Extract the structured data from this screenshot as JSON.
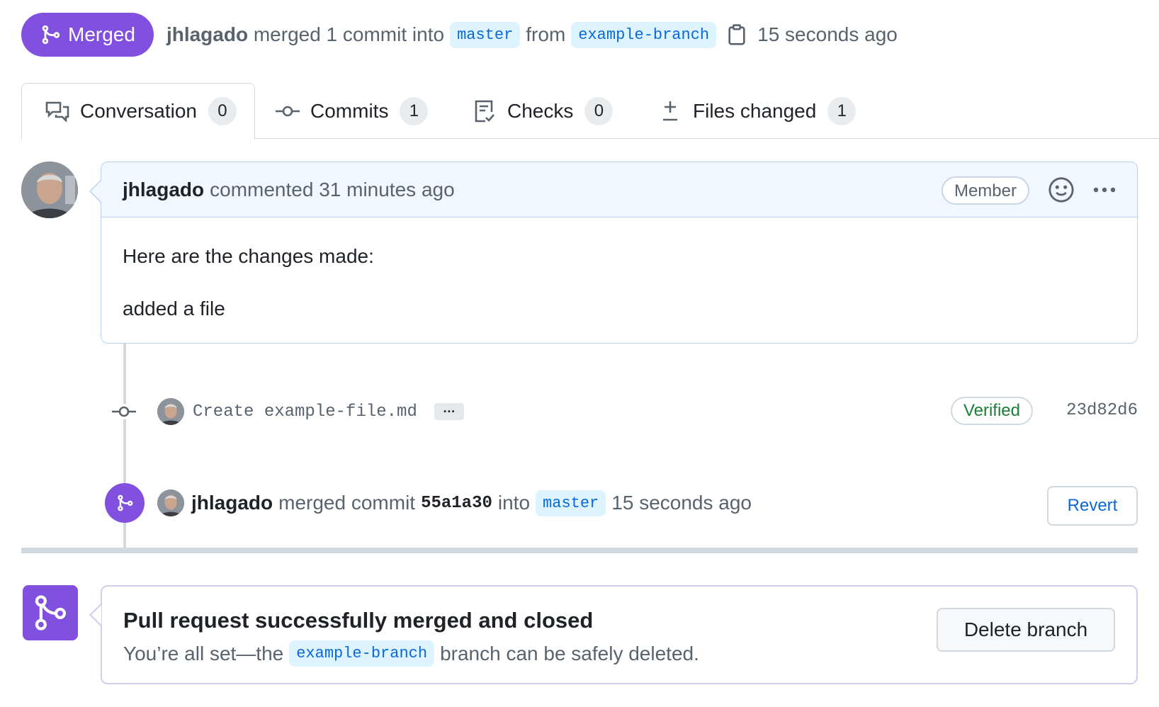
{
  "header": {
    "state_label": "Merged",
    "author": "jhlagado",
    "action_text": "merged 1 commit into",
    "base_branch": "master",
    "from_text": "from",
    "head_branch": "example-branch",
    "time": "15 seconds ago"
  },
  "tabs": [
    {
      "label": "Conversation",
      "count": "0",
      "icon": "comment-discussion-icon"
    },
    {
      "label": "Commits",
      "count": "1",
      "icon": "git-commit-icon"
    },
    {
      "label": "Checks",
      "count": "0",
      "icon": "checklist-icon"
    },
    {
      "label": "Files changed",
      "count": "1",
      "icon": "file-diff-icon"
    }
  ],
  "comment": {
    "author": "jhlagado",
    "meta": "commented 31 minutes ago",
    "role_badge": "Member",
    "body_line1": "Here are the changes made:",
    "body_line2": "added a file"
  },
  "commit": {
    "message": "Create example-file.md",
    "ellipsis": "…",
    "verified_label": "Verified",
    "sha": "23d82d6"
  },
  "merge_event": {
    "author": "jhlagado",
    "text_before": "merged commit",
    "sha": "55a1a30",
    "text_into": "into",
    "branch": "master",
    "time": "15 seconds ago",
    "revert_label": "Revert"
  },
  "merged_box": {
    "title": "Pull request successfully merged and closed",
    "sub_before": "You’re all set—the",
    "branch": "example-branch",
    "sub_after": "branch can be safely deleted.",
    "delete_label": "Delete branch"
  },
  "colors": {
    "merged_purple": "#8250df",
    "link_blue": "#0969da",
    "verified_green": "#1a7f37"
  }
}
